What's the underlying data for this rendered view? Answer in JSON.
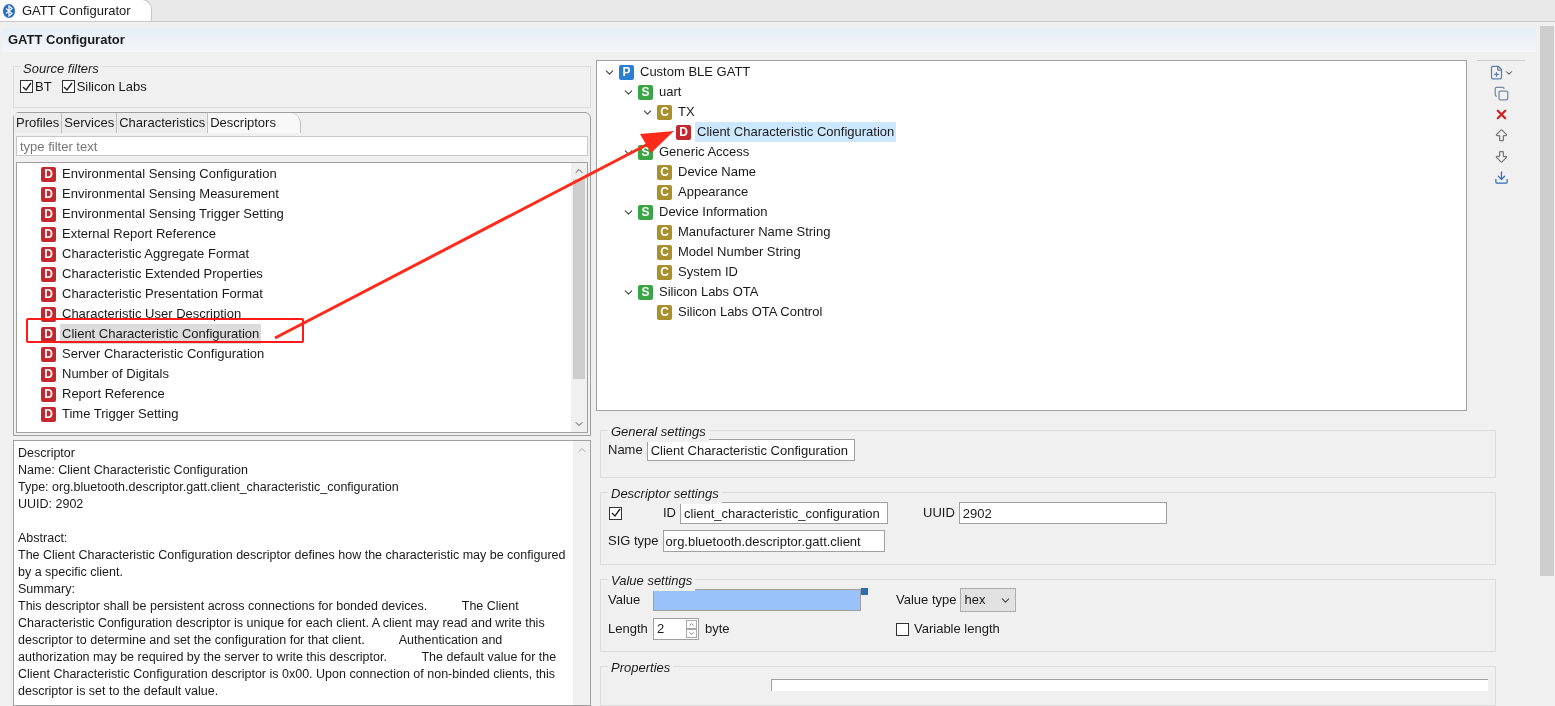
{
  "editor_tab": {
    "title": "GATT Configurator",
    "selected": true
  },
  "header": {
    "title": "GATT Configurator"
  },
  "source_filters": {
    "title": "Source filters",
    "options": [
      {
        "label": "BT",
        "checked": true
      },
      {
        "label": "Silicon Labs",
        "checked": true
      }
    ]
  },
  "library_tabs": [
    {
      "label": "Profiles",
      "selected": false
    },
    {
      "label": "Services",
      "selected": false
    },
    {
      "label": "Characteristics",
      "selected": false
    },
    {
      "label": "Descriptors",
      "selected": true
    }
  ],
  "filter": {
    "placeholder": "type filter text"
  },
  "library_items": [
    {
      "badge": "D",
      "kind": "descriptor",
      "label": "Environmental Sensing Configuration",
      "selected": false
    },
    {
      "badge": "D",
      "kind": "descriptor",
      "label": "Environmental Sensing Measurement",
      "selected": false
    },
    {
      "badge": "D",
      "kind": "descriptor",
      "label": "Environmental Sensing Trigger Setting",
      "selected": false
    },
    {
      "badge": "D",
      "kind": "descriptor",
      "label": "External Report Reference",
      "selected": false
    },
    {
      "badge": "D",
      "kind": "descriptor",
      "label": "Characteristic Aggregate Format",
      "selected": false
    },
    {
      "badge": "D",
      "kind": "descriptor",
      "label": "Characteristic Extended Properties",
      "selected": false
    },
    {
      "badge": "D",
      "kind": "descriptor",
      "label": "Characteristic Presentation Format",
      "selected": false
    },
    {
      "badge": "D",
      "kind": "descriptor",
      "label": "Characteristic User Description",
      "selected": false
    },
    {
      "badge": "D",
      "kind": "descriptor",
      "label": "Client Characteristic Configuration",
      "selected": true
    },
    {
      "badge": "D",
      "kind": "descriptor",
      "label": "Server Characteristic Configuration",
      "selected": false
    },
    {
      "badge": "D",
      "kind": "descriptor",
      "label": "Number of Digitals",
      "selected": false
    },
    {
      "badge": "D",
      "kind": "descriptor",
      "label": "Report Reference",
      "selected": false
    },
    {
      "badge": "D",
      "kind": "descriptor",
      "label": "Time Trigger Setting",
      "selected": false
    }
  ],
  "description": {
    "blocks": [
      [
        "Descriptor",
        "Name: Client Characteristic Configuration",
        "Type: org.bluetooth.descriptor.gatt.client_characteristic_configuration",
        "UUID: 2902"
      ],
      [
        "Abstract:",
        "The Client Characteristic Configuration descriptor defines how the characteristic may be configured by a specific client.",
        "Summary:",
        "This descriptor shall be persistent across connections for bonded devices.          The Client Characteristic Configuration descriptor is unique for each client. A client may read and write this descriptor to determine and set the configuration for that client.          Authentication and authorization may be required by the server to write this descriptor.          The default value for the Client Characteristic Configuration descriptor is 0x00. Upon connection of non-binded clients, this descriptor is set to the default value."
      ]
    ]
  },
  "tree": [
    {
      "badge": "P",
      "kind": "profile",
      "label": "Custom BLE GATT",
      "expanded": true,
      "selected": false,
      "children": [
        {
          "badge": "S",
          "kind": "service",
          "label": "uart",
          "expanded": true,
          "selected": false,
          "children": [
            {
              "badge": "C",
              "kind": "characteristic",
              "label": "TX",
              "expanded": true,
              "selected": false,
              "children": [
                {
                  "badge": "D",
                  "kind": "descriptor",
                  "label": "Client Characteristic Configuration",
                  "selected": true
                }
              ]
            }
          ]
        },
        {
          "badge": "S",
          "kind": "service",
          "label": "Generic Access",
          "expanded": true,
          "selected": false,
          "children": [
            {
              "badge": "C",
              "kind": "characteristic",
              "label": "Device Name",
              "selected": false
            },
            {
              "badge": "C",
              "kind": "characteristic",
              "label": "Appearance",
              "selected": false
            }
          ]
        },
        {
          "badge": "S",
          "kind": "service",
          "label": "Device Information",
          "expanded": true,
          "selected": false,
          "children": [
            {
              "badge": "C",
              "kind": "characteristic",
              "label": "Manufacturer Name String",
              "selected": false
            },
            {
              "badge": "C",
              "kind": "characteristic",
              "label": "Model Number String",
              "selected": false
            },
            {
              "badge": "C",
              "kind": "characteristic",
              "label": "System ID",
              "selected": false
            }
          ]
        },
        {
          "badge": "S",
          "kind": "service",
          "label": "Silicon Labs OTA",
          "expanded": true,
          "selected": false,
          "children": [
            {
              "badge": "C",
              "kind": "characteristic",
              "label": "Silicon Labs OTA Control",
              "selected": false
            }
          ]
        }
      ]
    }
  ],
  "general_settings": {
    "title": "General settings",
    "name_label": "Name",
    "name_value": "Client Characteristic Configuration"
  },
  "descriptor_settings": {
    "title": "Descriptor settings",
    "enabled": true,
    "id_label": "ID",
    "id_value": "client_characteristic_configuration",
    "uuid_label": "UUID",
    "uuid_value": "2902",
    "sig_label": "SIG type",
    "sig_value": "org.bluetooth.descriptor.gatt.client"
  },
  "value_settings": {
    "title": "Value settings",
    "value_label": "Value",
    "value_type_label": "Value type",
    "value_type": "hex",
    "length_label": "Length",
    "length_value": "2",
    "length_unit": "byte",
    "variable_length": {
      "label": "Variable length",
      "checked": false
    }
  },
  "properties": {
    "title": "Properties"
  }
}
